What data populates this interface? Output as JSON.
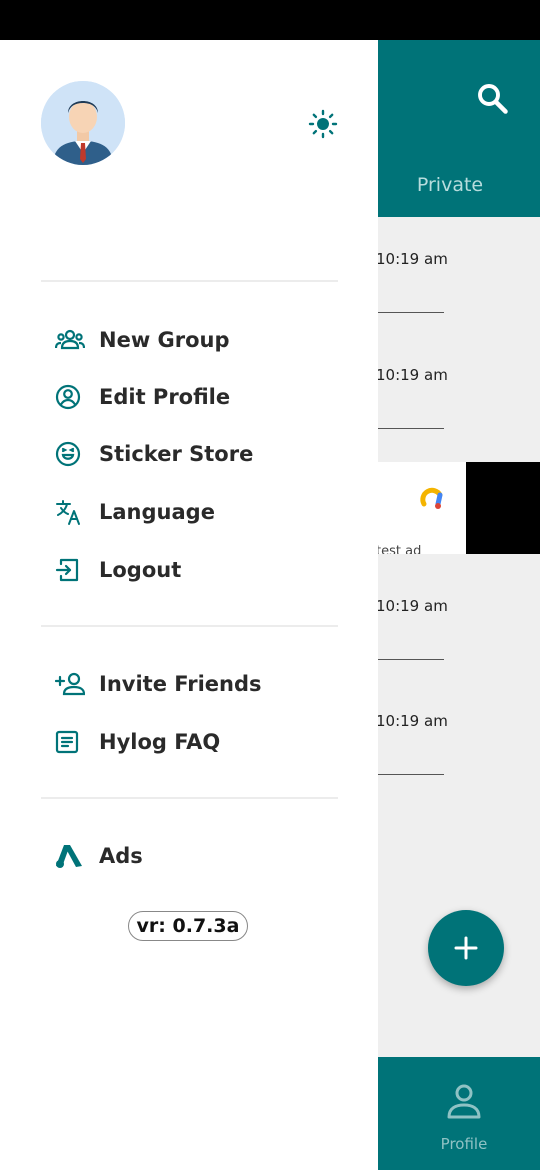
{
  "colors": {
    "primary": "#007378",
    "drawer_bg": "#ffffff",
    "text": "#2a2a2a"
  },
  "header": {
    "tab_private": "Private",
    "search_icon": "search-icon"
  },
  "chats": [
    {
      "time": "10:19 am"
    },
    {
      "time": "10:19 am"
    },
    {
      "time": "10:19 am"
    },
    {
      "time": "10:19 am"
    }
  ],
  "ad": {
    "text": "test ad"
  },
  "bottom_nav": {
    "profile_label": "Profile"
  },
  "drawer": {
    "menu": [
      {
        "label": "New Group",
        "icon": "group-icon"
      },
      {
        "label": "Edit Profile",
        "icon": "account-circle-icon"
      },
      {
        "label": "Sticker Store",
        "icon": "sticker-icon"
      },
      {
        "label": "Language",
        "icon": "translate-icon"
      },
      {
        "label": "Logout",
        "icon": "logout-icon"
      }
    ],
    "menu2": [
      {
        "label": "Invite Friends",
        "icon": "add-person-icon"
      },
      {
        "label": "Hylog FAQ",
        "icon": "article-icon"
      }
    ],
    "menu3": [
      {
        "label": "Ads",
        "icon": "ads-icon"
      }
    ],
    "version": "vr: 0.7.3a"
  }
}
